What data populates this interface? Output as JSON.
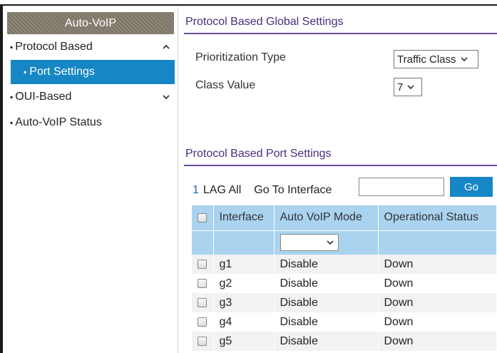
{
  "sidebar": {
    "header": "Auto-VoIP",
    "items": [
      {
        "label": "Protocol Based",
        "expanded": true
      },
      {
        "label": "Port Settings",
        "selected": true
      },
      {
        "label": "OUI-Based",
        "expanded": false
      },
      {
        "label": "Auto-VoIP Status"
      }
    ]
  },
  "global_settings": {
    "title": "Protocol Based Global Settings",
    "prioritization_type": {
      "label": "Prioritization Type",
      "value": "Traffic Class"
    },
    "class_value": {
      "label": "Class Value",
      "value": "7"
    }
  },
  "port_settings": {
    "title": "Protocol Based Port Settings",
    "page": "1",
    "lag_all": "LAG All",
    "goto_label": "Go To Interface",
    "goto_value": "",
    "go_button": "Go",
    "columns": [
      "Interface",
      "Auto VoIP Mode",
      "Operational Status"
    ],
    "rows": [
      {
        "interface": "g1",
        "mode": "Disable",
        "status": "Down"
      },
      {
        "interface": "g2",
        "mode": "Disable",
        "status": "Down"
      },
      {
        "interface": "g3",
        "mode": "Disable",
        "status": "Down"
      },
      {
        "interface": "g4",
        "mode": "Disable",
        "status": "Down"
      },
      {
        "interface": "g5",
        "mode": "Disable",
        "status": "Down"
      }
    ]
  },
  "colors": {
    "accent_blue": "#1686c4",
    "section_purple": "#4a2d7a",
    "table_header": "#a9d3ef"
  },
  "icons": {
    "expanded": "chevron-up-icon",
    "collapsed": "chevron-down-icon",
    "dropdown": "chevron-down-icon"
  }
}
